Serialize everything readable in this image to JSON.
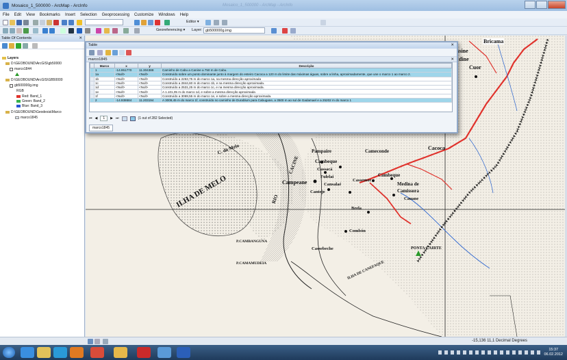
{
  "window": {
    "title": "Mosaico_1_500000 - ArcMap - ArcInfo",
    "faded_title": "Mosaico_1_500000 - ArcMap - ArcInfo"
  },
  "menu": [
    "File",
    "Edit",
    "View",
    "Bookmarks",
    "Insert",
    "Selection",
    "Geoprocessing",
    "Customize",
    "Windows",
    "Help"
  ],
  "toolbar": {
    "editor_label": "Editor ▾",
    "georef_label": "Georeferencing ▾",
    "layer_label": "Layer:",
    "layer_value": "gb500000g.img"
  },
  "toc": {
    "title": "Table Of Contents",
    "close": "✕",
    "items": [
      {
        "label": "Layers"
      },
      {
        "label": "D:\\GEOBOUND\\ArcGIS\\gb50000"
      },
      {
        "label": "marco1844"
      },
      {
        "label": "D:\\GEOBOUND\\ArcGIS\\GB50000"
      },
      {
        "label": "gb500000g.img"
      },
      {
        "label": "RGB"
      },
      {
        "label": "Red: Band_1"
      },
      {
        "label": "Green: Band_2"
      },
      {
        "label": "Blue: Band_3"
      },
      {
        "label": "D:\\GEOBOUND\\Geodesia\\Marco"
      },
      {
        "label": "marco1845"
      }
    ],
    "colors": {
      "red": "#e0322c",
      "green": "#37b34a",
      "blue": "#2b55d6"
    }
  },
  "table": {
    "title": "Table",
    "close": "✕",
    "subtitle": "marco1845",
    "subtitle_close": "✕",
    "columns": [
      "Marco",
      "x",
      "y",
      "Descrição"
    ],
    "rows": [
      {
        "marco": "1",
        "x": "-14.951770",
        "y": "11.304388",
        "desc": "Caminho de Cabu a Canine a 750 m de Cabu.",
        "selected": true
      },
      {
        "marco": "1a",
        "x": "<Null>",
        "y": "<Null>",
        "desc": "Construído sobre um ponto dominante junto à margem do esteiro Cacoca a 120 m do limite das máximas águas, sobre a linha, aproximadamente, que une o marco 1 ao marco 2.",
        "selected": true
      },
      {
        "marco": "1b",
        "x": "<Null>",
        "y": "<Null>",
        "desc": "Construído a 2263,75 m do marco 1a, na mesma direcção aproximada",
        "selected": false
      },
      {
        "marco": "1c",
        "x": "<Null>",
        "y": "<Null>",
        "desc": "Construído a 2844,60 m do marco 1b, e na mesma direcção aproximada.",
        "selected": false
      },
      {
        "marco": "1d",
        "x": "<Null>",
        "y": "<Null>",
        "desc": "Construído a 2531,25 m do marco 1c, e na mesma direcção aproximada.",
        "selected": false
      },
      {
        "marco": "1e",
        "x": "<Null>",
        "y": "<Null>",
        "desc": "A 1.101,05 m do marco 1d, e sobre a mesma direcção aproximada",
        "selected": false
      },
      {
        "marco": "1f",
        "x": "<Null>",
        "y": "<Null>",
        "desc": "Construído a 3069,55 m do marco 1e, e sobre a mesma direcção aproximada.",
        "selected": false
      },
      {
        "marco": "2",
        "x": "-14.938684",
        "y": "11.203194",
        "desc": "A 3009,45 m do marco 1f, construído no caminho de Durablum para Cabugane, a 3500 m ao sul de Gadamael e a 25202 m do marco 1",
        "selected": true
      }
    ],
    "nav": {
      "first": "⏮",
      "prev": "◀",
      "record": "1",
      "next": "▶",
      "last": "⏭",
      "status": "(1 out of 282 Selected)"
    },
    "tab": "marco1845"
  },
  "map_labels": {
    "ilha": "ILHA DE MELO",
    "melo": "C. do Melo",
    "rio": "RIO",
    "cacine": "CACINE",
    "campeane": "Campeane",
    "cameconde": "Cameconde",
    "cacoca": "Cacoca",
    "cambeque": "Cambeque",
    "cassaca": "Cassacá",
    "fulelai": "Fulelai",
    "cansalae": "Cansalaé",
    "canteje": "Canteje",
    "cassemor": "Cassemor",
    "medina": "Medina de",
    "camissora": "Camissora",
    "cauane": "Cauane",
    "brela": "Brela",
    "cobdon": "Combón",
    "cassebeche": "Cassebeche",
    "ponta": "PONTA CAIRTE",
    "pampaire": "Pampaire",
    "cambeque2": "Cambeque",
    "carnabanguna": "P.CAMBANGUNA",
    "camamudeia": "P.CAMAMUDEIA",
    "ilhacanefaque": "ILHA DE CANEFAQUE",
    "cacoca_hd": "Cacoca",
    "bricama": "Bricama",
    "issine": "issine",
    "dine": "dine",
    "cuor": "Cuor"
  },
  "status": {
    "coords": "-15,136  11,1  Decimal Degrees"
  },
  "clock": {
    "time": "15:37",
    "date": "06.02.2012"
  }
}
